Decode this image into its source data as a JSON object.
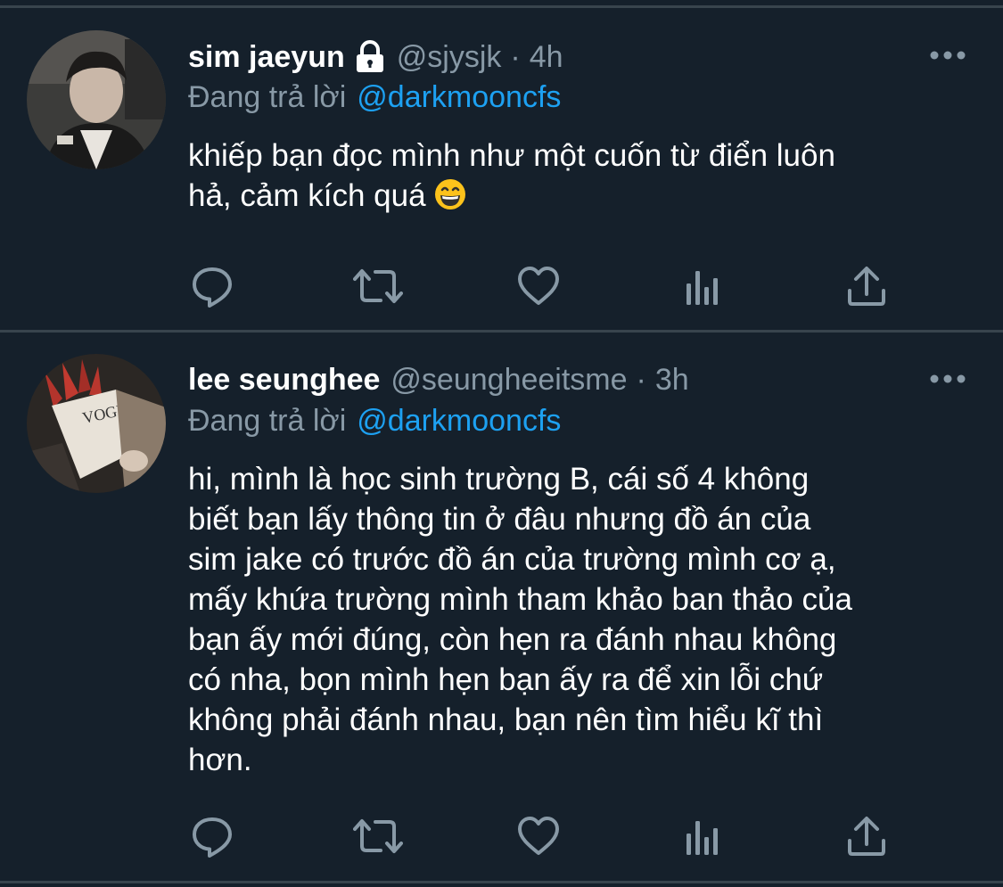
{
  "tweets": [
    {
      "display_name": "sim jaeyun",
      "protected": true,
      "handle": "@sjysjk",
      "separator": "·",
      "time": "4h",
      "reply_label": "Đang trả lời",
      "reply_to": "@darkmooncfs",
      "text_lines": [
        "khiếp bạn đọc mình như một cuốn từ điển luôn",
        "hả, cảm kích quá"
      ],
      "emoji": "grinning-face-with-smiling-eyes"
    },
    {
      "display_name": "lee seunghee",
      "protected": false,
      "handle": "@seungheeitsme",
      "separator": "·",
      "time": "3h",
      "reply_label": "Đang trả lời",
      "reply_to": "@darkmooncfs",
      "text_lines": [
        "hi, mình là học sinh trường B, cái số 4 không",
        "biết bạn lấy thông tin ở đâu nhưng đồ án của",
        "sim jake có trước đồ án của trường mình cơ ạ,",
        "mấy khứa trường mình tham khảo ban thảo của",
        "bạn ấy mới đúng, còn hẹn ra đánh nhau không",
        "có nha, bọn mình hẹn bạn ấy ra để xin lỗi chứ",
        "không phải đánh nhau, bạn nên tìm hiểu kĩ thì",
        "hơn."
      ]
    }
  ],
  "icons": {
    "more": "more-horizontal-icon",
    "reply": "reply-icon",
    "retweet": "retweet-icon",
    "like": "like-icon",
    "analytics": "analytics-icon",
    "share": "share-icon",
    "lock": "lock-icon"
  },
  "colors": {
    "background": "#15202b",
    "divider": "#38444d",
    "secondary_text": "#8899a6",
    "mention": "#1da1f2",
    "icon": "#8899a6"
  }
}
